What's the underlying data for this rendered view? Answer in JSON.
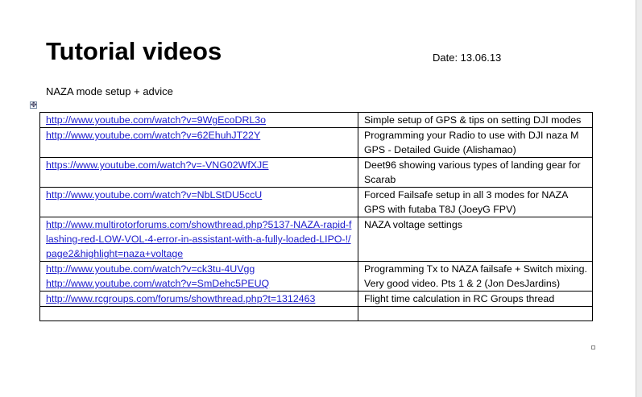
{
  "document": {
    "title": "Tutorial videos",
    "date": "Date: 13.06.13",
    "section_heading": "NAZA mode setup + advice"
  },
  "table": {
    "rows": [
      {
        "links": [
          "http://www.youtube.com/watch?v=9WgEcoDRL3o"
        ],
        "description": "Simple setup of GPS & tips on setting DJI modes"
      },
      {
        "links": [
          "http://www.youtube.com/watch?v=62EhuhJT22Y"
        ],
        "description": "Programming your Radio to use with DJI naza M GPS - Detailed Guide (Alishamao)"
      },
      {
        "links": [
          "https://www.youtube.com/watch?v=-VNG02WfXJE"
        ],
        "description": "Deet96 showing various types of landing gear for Scarab"
      },
      {
        "links": [
          "http://www.youtube.com/watch?v=NbLStDU5ccU"
        ],
        "description": "Forced Failsafe setup in all 3 modes for NAZA GPS with futaba T8J (JoeyG FPV)"
      },
      {
        "links": [
          "http://www.multirotorforums.com/showthread.php?5137-NAZA-rapid-flashing-red-LOW-VOL-4-error-in-assistant-with-a-fully-loaded-LIPO-!/page2&highlight=naza+voltage"
        ],
        "description": "NAZA voltage settings"
      },
      {
        "links": [
          "http://www.youtube.com/watch?v=ck3tu-4UVgg",
          "http://www.youtube.com/watch?v=SmDehc5PEUQ"
        ],
        "description": "Programming Tx to NAZA failsafe + Switch mixing. Very good video. Pts 1 & 2 (Jon DesJardins)"
      },
      {
        "links": [
          "http://www.rcgroups.com/forums/showthread.php?t=1312463"
        ],
        "description": "Flight time calculation in RC Groups thread"
      }
    ]
  }
}
